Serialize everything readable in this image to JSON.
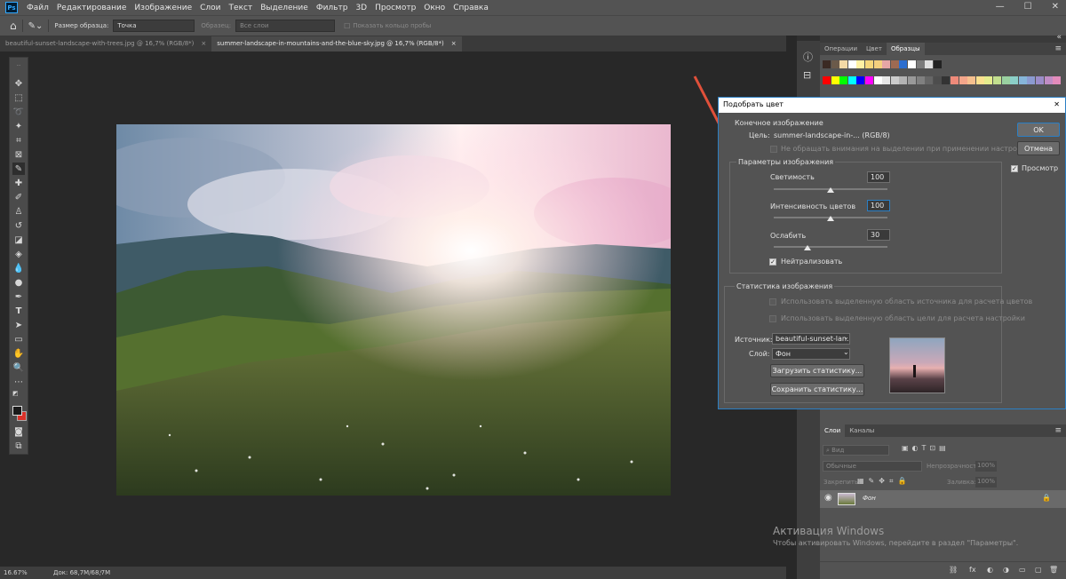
{
  "menu": {
    "logo": "Ps",
    "items": [
      "Файл",
      "Редактирование",
      "Изображение",
      "Слои",
      "Текст",
      "Выделение",
      "Фильтр",
      "3D",
      "Просмотр",
      "Окно",
      "Справка"
    ]
  },
  "window_controls": {
    "minimize": "—",
    "maximize": "☐",
    "close": "✕"
  },
  "options_bar": {
    "sample_size_label": "Размер образца:",
    "sample_size_value": "Точка",
    "sample_label": "Образец:",
    "sample_value": "Все слои",
    "show_ring_label": "Показать кольцо пробы"
  },
  "tabs": [
    {
      "label": "beautiful-sunset-landscape-with-trees.jpg @ 16,7% (RGB/8*)",
      "close": "×"
    },
    {
      "label": "summer-landscape-in-mountains-and-the-blue-sky.jpg @ 16,7% (RGB/8*)",
      "close": "×"
    }
  ],
  "status": {
    "zoom": "16.67%",
    "doc": "Док: 68,7M/68,7M",
    "arrow": "›"
  },
  "swatches_panel": {
    "tabs": [
      "Операции",
      "Цвет",
      "Образцы"
    ],
    "menu": "≡",
    "collapse": "«",
    "row1": [
      "#3b2a23",
      "#6b5a4a",
      "#f3d9a6",
      "#ffffff",
      "#fff1a3",
      "#f5d77a",
      "#f3d07e",
      "#e5a6a6",
      "#9e6a52",
      "#2c6ecf",
      "#ffffff",
      "#7c7c7c",
      "#e0e0e0",
      "#222222"
    ],
    "row2": [
      "#ff0000",
      "#ffff00",
      "#00ff00",
      "#00ffff",
      "#0000ff",
      "#ff00ff",
      "#ffffff",
      "#e6e6e6",
      "#cccccc",
      "#b3b3b3",
      "#999999",
      "#808080",
      "#666666",
      "#4d4d4d",
      "#333333",
      "#ef8a7a",
      "#f4a68a",
      "#f6c08e",
      "#fbe08f",
      "#e5ec8d",
      "#c2df8e",
      "#99d1a0",
      "#8bcfc8",
      "#86b5d9",
      "#8b9ad0",
      "#9b8cc8",
      "#c08cc5",
      "#e38bbb"
    ]
  },
  "dialog": {
    "title": "Подобрать цвет",
    "close": "✕",
    "dest_group": "Конечное изображение",
    "target_label": "Цель:",
    "target_value": "summer-landscape-in-... (RGB/8)",
    "ignore_selection": "Не обращать внимания на выделении при применении настроек",
    "options_group": "Параметры изображения",
    "luminance_label": "Светимость",
    "luminance_value": "100",
    "luminance_pos": 0.5,
    "intensity_label": "Интенсивность цветов",
    "intensity_value": "100",
    "intensity_pos": 0.5,
    "fade_label": "Ослабить",
    "fade_value": "30",
    "fade_pos": 0.3,
    "neutralize_label": "Нейтрализовать",
    "neutralize_checked": "✓",
    "stats_group": "Статистика изображения",
    "use_source_sel": "Использовать выделенную область источника для расчета цветов",
    "use_target_sel": "Использовать выделенную область цели для расчета настройки",
    "source_label": "Источник:",
    "source_value": "beautiful-sunset-lan...",
    "layer_label": "Слой:",
    "layer_value": "Фон",
    "dropdown_glyph": "⌄",
    "load_stats": "Загрузить статистику...",
    "save_stats": "Сохранить статистику...",
    "ok": "OK",
    "cancel": "Отмена",
    "preview": "Просмотр",
    "preview_checked": "✓"
  },
  "layers_panel": {
    "tabs": [
      "Слои",
      "Каналы"
    ],
    "menu": "≡",
    "filter_placeholder": "Вид",
    "blend": "Обычные",
    "opacity_label": "Непрозрачность:",
    "opacity_value": "100%",
    "lock_label": "Закрепить:",
    "fill_label": "Заливка:",
    "fill_value": "100%",
    "layer_name": "Фон",
    "lock_icon": "🔒",
    "eye": "◉",
    "bottom_icons": [
      "⛓",
      "fx",
      "◐",
      "◑",
      "▭",
      "▢",
      "🗑"
    ]
  },
  "watermark": {
    "line1": "Активация Windows",
    "line2": "Чтобы активировать Windows, перейдите в раздел \"Параметры\"."
  },
  "colors": {
    "accent": "#31a8ff",
    "arrow": "#e0503a",
    "fg": "#1a1a1a",
    "bg": "#d9322a"
  }
}
